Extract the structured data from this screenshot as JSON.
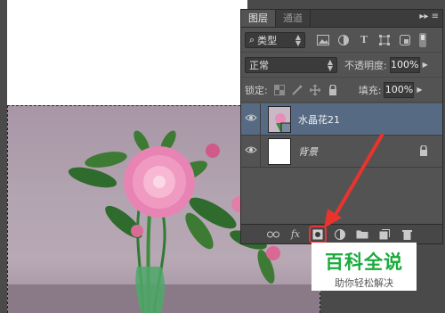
{
  "panel": {
    "tabs": [
      {
        "label": "图层",
        "active": true
      },
      {
        "label": "通道",
        "active": false
      }
    ],
    "menu_icon": "double-chevron-menu-icon"
  },
  "filter": {
    "kind_label": "类型",
    "icons": [
      "image-filter-icon",
      "adjustment-filter-icon",
      "text-filter-icon",
      "shape-filter-icon",
      "smart-object-filter-icon"
    ]
  },
  "blend": {
    "mode": "正常",
    "opacity_label": "不透明度:",
    "opacity_value": "100%"
  },
  "lock": {
    "label": "锁定:",
    "icons": [
      "lock-transparency-icon",
      "lock-pixels-icon",
      "lock-position-icon",
      "lock-all-icon"
    ],
    "fill_label": "填充:",
    "fill_value": "100%"
  },
  "layers": [
    {
      "name": "水晶花21",
      "visible": true,
      "selected": true,
      "has_mask": true
    },
    {
      "name": "背景",
      "visible": true,
      "selected": false,
      "locked": true
    }
  ],
  "bottom_icons": [
    "link-layers-icon",
    "fx-icon",
    "add-mask-icon",
    "adjustment-layer-icon",
    "new-group-icon",
    "new-layer-icon",
    "delete-layer-icon"
  ],
  "watermark": {
    "title": "百科全说",
    "subtitle": "助你轻松解决"
  },
  "colors": {
    "panel_bg": "#535353",
    "selected_layer": "#566a84",
    "arrow": "#e8342c",
    "watermark_green": "#1aab3c"
  }
}
